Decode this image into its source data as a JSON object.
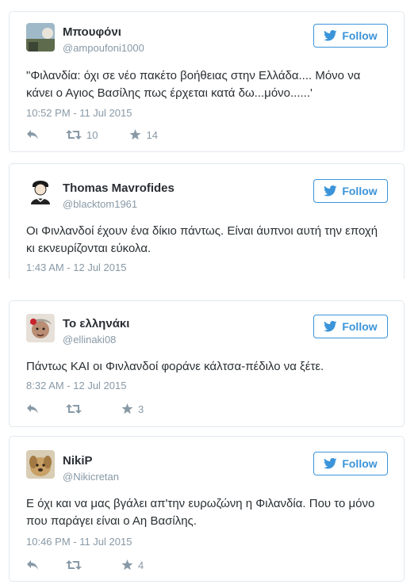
{
  "colors": {
    "accent": "#3b94d9",
    "muted": "#8899a6",
    "text": "#292f33",
    "border": "#e1e8ed"
  },
  "follow_label": "Follow",
  "tweets": [
    {
      "name": "Μπουφόνι",
      "handle": "@ampoufoni1000",
      "text": "\"Φιλανδία: όχι σε νέο πακέτο βοήθειας στην Ελλάδα.... Μόνο να κάνει ο Αγιος Βασίλης πως έρχεται κατά δω...μόνο......'",
      "time": "10:52 PM - 11 Jul 2015",
      "retweets": "10",
      "likes": "14"
    },
    {
      "name": "Thomas Mavrofides",
      "handle": "@blacktom1961",
      "text": "Οι Φινλανδοί έχουν ένα δίκιο πάντως. Είναι άυπνοι αυτή την εποχή κι εκνευρίζονται εύκολα.",
      "time": "1:43 AM - 12 Jul 2015"
    },
    {
      "name": "Το ελληνάκι",
      "handle": "@ellinaki08",
      "text": "Πάντως ΚΑΙ οι Φινλανδοί φοράνε κάλτσα-πέδιλο να ξέτε.",
      "time": "8:32 AM - 12 Jul 2015",
      "retweets": "",
      "likes": "3"
    },
    {
      "name": "NikiP",
      "handle": "@Nikicretan",
      "text": "Ε όχι και να μας βγάλει απ'την ευρωζώνη η Φιλανδία. Που το μόνο που παράγει είναι ο Αη Βασίλης.",
      "time": "10:46 PM - 11 Jul 2015",
      "retweets": "",
      "likes": "4"
    }
  ]
}
